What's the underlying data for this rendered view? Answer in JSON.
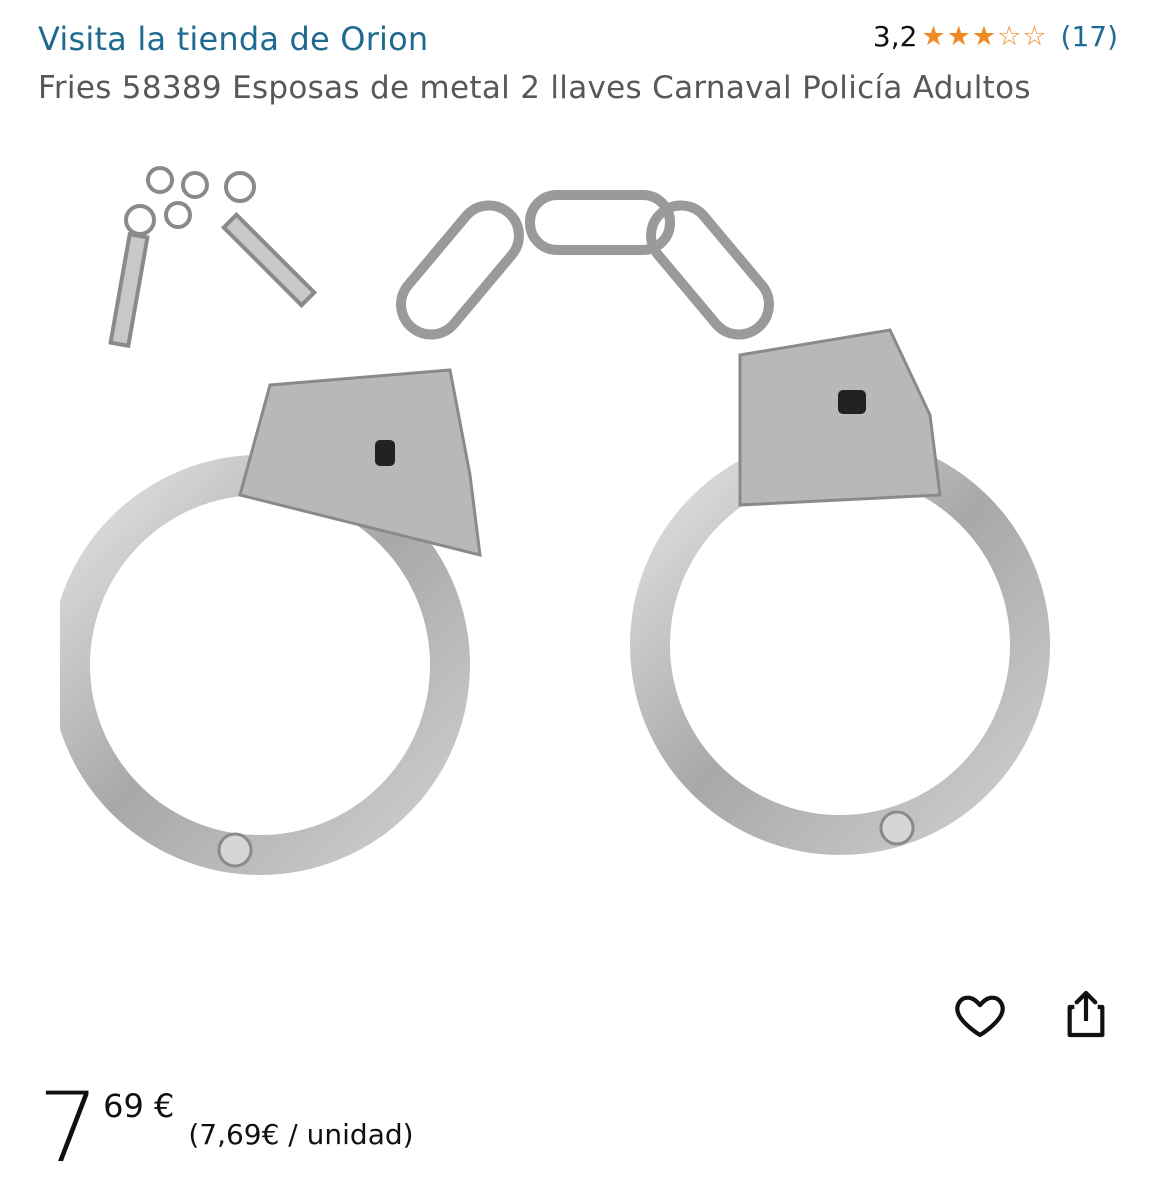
{
  "store": {
    "link_text": "Visita la tienda de Orion"
  },
  "rating": {
    "value": "3,2",
    "stars": 3,
    "max_stars": 5,
    "count": "(17)"
  },
  "product": {
    "title": "Fries 58389 Esposas de metal 2 llaves Carnaval Policía Adultos"
  },
  "price": {
    "whole": "7",
    "fraction": "69 €",
    "per_unit": "(7,69€ / unidad)"
  },
  "actions": {
    "wishlist_icon": "heart-icon",
    "share_icon": "share-icon"
  },
  "colors": {
    "link": "#1e6a90",
    "star": "#f08a24",
    "title": "#565959"
  }
}
